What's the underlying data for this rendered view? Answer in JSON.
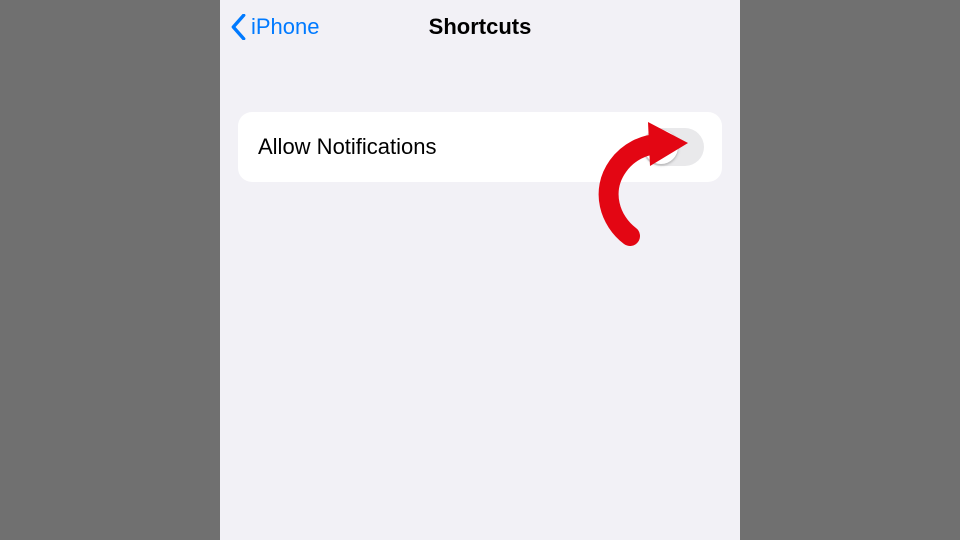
{
  "nav": {
    "back_label": "iPhone",
    "title": "Shortcuts"
  },
  "settings": {
    "allow_notifications": {
      "label": "Allow Notifications",
      "value": false
    }
  },
  "colors": {
    "ios_blue": "#007aff",
    "callout_red": "#e30613",
    "toggle_off_bg": "#e9e9eb",
    "screen_bg": "#f2f1f6"
  }
}
